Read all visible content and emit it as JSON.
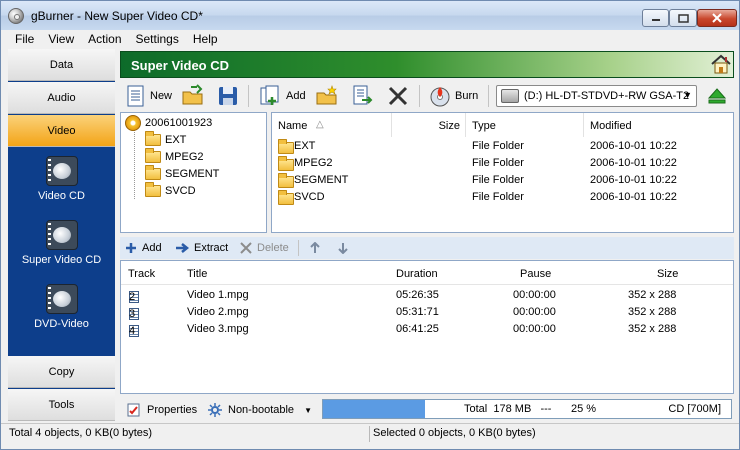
{
  "window": {
    "title": "gBurner - New Super Video CD*"
  },
  "menu": [
    "File",
    "View",
    "Action",
    "Settings",
    "Help"
  ],
  "nav": {
    "data": "Data",
    "audio": "Audio",
    "video": "Video",
    "sub_items": [
      "Video CD",
      "Super Video CD",
      "DVD-Video"
    ],
    "copy": "Copy",
    "tools": "Tools"
  },
  "header": {
    "title": "Super Video CD"
  },
  "toolbar": {
    "new_label": "New",
    "add_label": "Add",
    "burn_label": "Burn",
    "drive": "(D:) HL-DT-STDVD+-RW GSA-T2"
  },
  "tree": {
    "root": "20061001923",
    "children": [
      "EXT",
      "MPEG2",
      "SEGMENT",
      "SVCD"
    ]
  },
  "filelist": {
    "columns": [
      "Name",
      "Size",
      "Type",
      "Modified"
    ],
    "sort_indicator": "△",
    "rows": [
      {
        "name": "EXT",
        "size": "",
        "type": "File Folder",
        "modified": "2006-10-01 10:22"
      },
      {
        "name": "MPEG2",
        "size": "",
        "type": "File Folder",
        "modified": "2006-10-01 10:22"
      },
      {
        "name": "SEGMENT",
        "size": "",
        "type": "File Folder",
        "modified": "2006-10-01 10:22"
      },
      {
        "name": "SVCD",
        "size": "",
        "type": "File Folder",
        "modified": "2006-10-01 10:22"
      }
    ]
  },
  "tracktools": {
    "add": "Add",
    "extract": "Extract",
    "delete": "Delete"
  },
  "tracklist": {
    "columns": [
      "Track",
      "Title",
      "Duration",
      "Pause",
      "Size"
    ],
    "rows": [
      {
        "track": "2",
        "title": "Video 1.mpg",
        "duration": "05:26:35",
        "pause": "00:00:00",
        "size": "352 x 288"
      },
      {
        "track": "3",
        "title": "Video 2.mpg",
        "duration": "05:31:71",
        "pause": "00:00:00",
        "size": "352 x 288"
      },
      {
        "track": "4",
        "title": "Video 3.mpg",
        "duration": "06:41:25",
        "pause": "00:00:00",
        "size": "352 x 288"
      }
    ]
  },
  "bottombar": {
    "properties": "Properties",
    "bootable": "Non-bootable",
    "capacity_fraction": 0.25,
    "total_label": "Total",
    "total_value": "178 MB",
    "dashes": "---",
    "percent": "25 %",
    "disc": "CD [700M]"
  },
  "status": {
    "left": "Total 4 objects, 0 KB(0 bytes)",
    "right": "Selected 0 objects, 0 KB(0 bytes)"
  },
  "colors": {
    "nav_background": "#0d3e8b",
    "active_nav": "#f3a417",
    "header_green": "#2f8e2c",
    "capacity_fill": "#5b9be3"
  }
}
